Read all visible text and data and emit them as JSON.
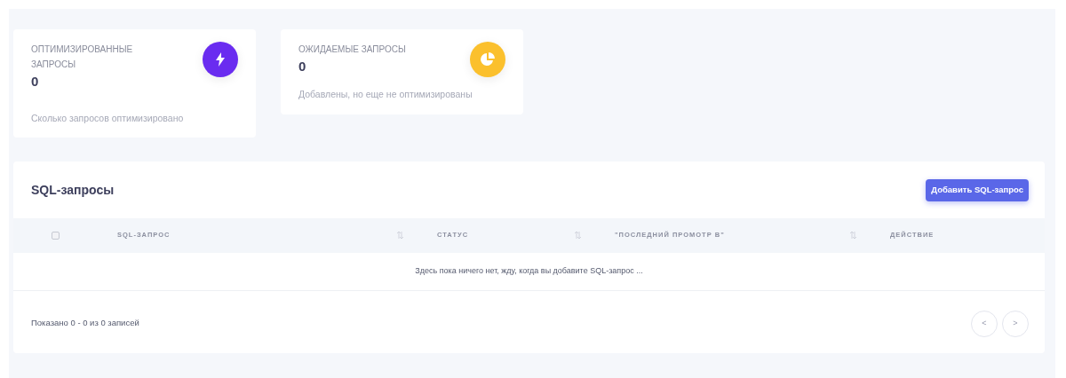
{
  "stat_cards": [
    {
      "title": "ОПТИМИЗИРОВАННЫЕ ЗАПРОСЫ",
      "value": "0",
      "note": "Сколько запросов оптимизировано",
      "color": "#6a2cf0"
    },
    {
      "title": "ОЖИДАЕМЫЕ ЗАПРОСЫ",
      "value": "0",
      "note": "Добавлены, но еще не оптимизированы",
      "color": "#fbc02d"
    }
  ],
  "table_card": {
    "title": "SQL-запросы",
    "add_button": "Добавить SQL-запрос",
    "select_all": {
      "checked": false
    },
    "columns": [
      {
        "label": "SQL-ЗАПРОС",
        "sortable": true
      },
      {
        "label": "СТАТУС",
        "sortable": true
      },
      {
        "label": "\"ПОСЛЕДНИЙ ПРОМОТР В\"",
        "sortable": true
      },
      {
        "label": "ДЕЙСТВИЕ",
        "sortable": false
      }
    ],
    "empty_message": "Здесь пока ничего нет, жду, когда вы добавите SQL-запрос ...",
    "footer_info": "Показано 0 - 0 из 0 записей",
    "pager": [
      "<",
      ">"
    ]
  }
}
